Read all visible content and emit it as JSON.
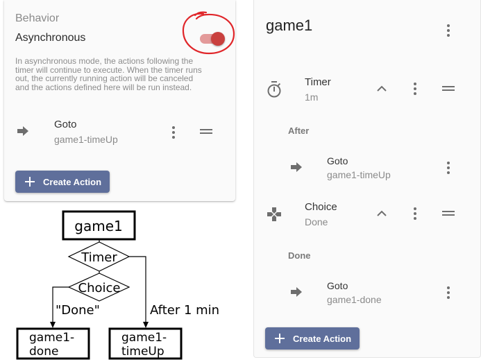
{
  "left_card": {
    "section_title": "Behavior",
    "async_label": "Asynchronous",
    "async_enabled": true,
    "description_lines": [
      "In asynchronous mode, the actions following the",
      "timer will continue to execute. When the timer runs",
      "out, the currently running action will be canceled",
      "and the actions defined here will be run instead."
    ],
    "action": {
      "type": "Goto",
      "target": "game1-timeUp",
      "icon": "arrow-right-icon"
    },
    "create_button": "Create Action"
  },
  "right_panel": {
    "title": "game1",
    "timer": {
      "title": "Timer",
      "sub": "1m",
      "icon": "stopwatch-icon"
    },
    "after_label": "After",
    "after_action": {
      "type": "Goto",
      "target": "game1-timeUp"
    },
    "choice": {
      "title": "Choice",
      "sub": "Done",
      "icon": "gamepad-icon"
    },
    "done_label": "Done",
    "done_action": {
      "type": "Goto",
      "target": "game1-done"
    },
    "create_button": "Create Action"
  },
  "flowchart": {
    "start": "game1",
    "timer": "Timer",
    "choice": "Choice",
    "edge_done": "\"Done\"",
    "edge_after": "After 1 min",
    "node_done": [
      "game1-",
      "done"
    ],
    "node_timeup": [
      "game1-",
      "timeUp"
    ]
  },
  "colors": {
    "accent_button": "#5f6f9b",
    "toggle_on": "#c9403e",
    "annotation_circle": "#e0262a"
  }
}
